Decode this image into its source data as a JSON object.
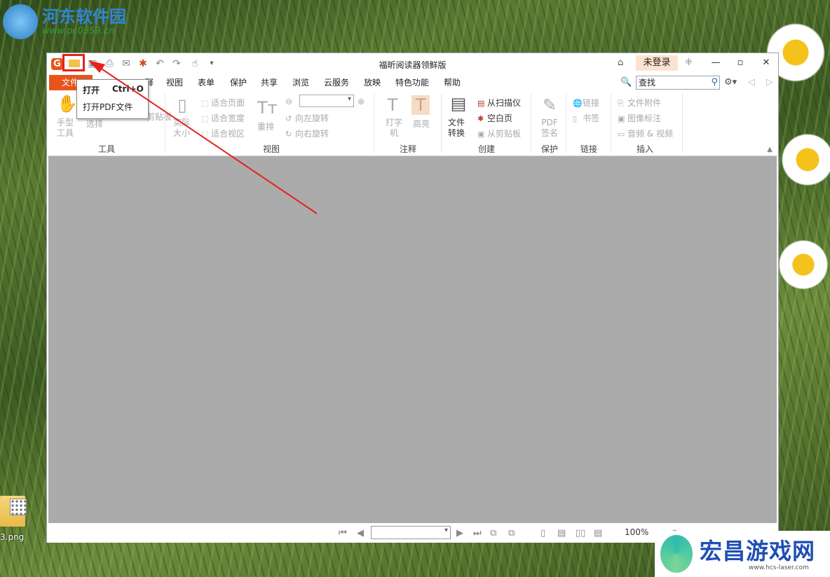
{
  "watermark_top": {
    "title": "河东软件园",
    "url": "www.pc0359.cn"
  },
  "watermark_bottom": {
    "title": "宏昌游戏网",
    "url": "www.hcs-laser.com"
  },
  "desktop": {
    "file_label": "3.png"
  },
  "window": {
    "title": "福昕阅读器领鲜版",
    "login_label": "未登录",
    "logo_letter": "G"
  },
  "menu": {
    "file": "文件",
    "items": [
      "视图",
      "表单",
      "保护",
      "共享",
      "浏览",
      "云服务",
      "放映",
      "特色功能",
      "帮助"
    ],
    "partial_item": "释",
    "search_value": "查找"
  },
  "dropdown": {
    "open_label": "打开",
    "open_shortcut": "Ctrl+O",
    "open_pdf_label": "打开PDF文件"
  },
  "ribbon": {
    "tools": {
      "hand_tool": "手型工具",
      "select": "选择",
      "clipboard": "剪贴板",
      "group": "工具"
    },
    "view": {
      "actual_size": "实际大小",
      "fit_page": "适合页面",
      "fit_width": "适合宽度",
      "fit_visible": "适合视区",
      "reflow": "重排",
      "rotate_left": "向左旋转",
      "rotate_right": "向右旋转",
      "group": "视图"
    },
    "comment": {
      "typewriter": "打字机",
      "highlight": "高亮",
      "group": "注释"
    },
    "create": {
      "file_convert": "文件转换",
      "from_scanner": "从扫描仪",
      "blank_page": "空白页",
      "from_clipboard": "从剪贴板",
      "group": "创建"
    },
    "protect": {
      "pdf_sign": "PDF签名",
      "group": "保护"
    },
    "links": {
      "link": "链接",
      "bookmark": "书签",
      "group": "链接"
    },
    "insert": {
      "file_attachment": "文件附件",
      "image_annotation": "图像标注",
      "audio_video": "音频 & 视频",
      "group": "插入"
    }
  },
  "status": {
    "zoom": "100%"
  },
  "colors": {
    "accent": "#e8541c",
    "highlight_red": "#e3231b",
    "doc_bg": "#ababab"
  }
}
